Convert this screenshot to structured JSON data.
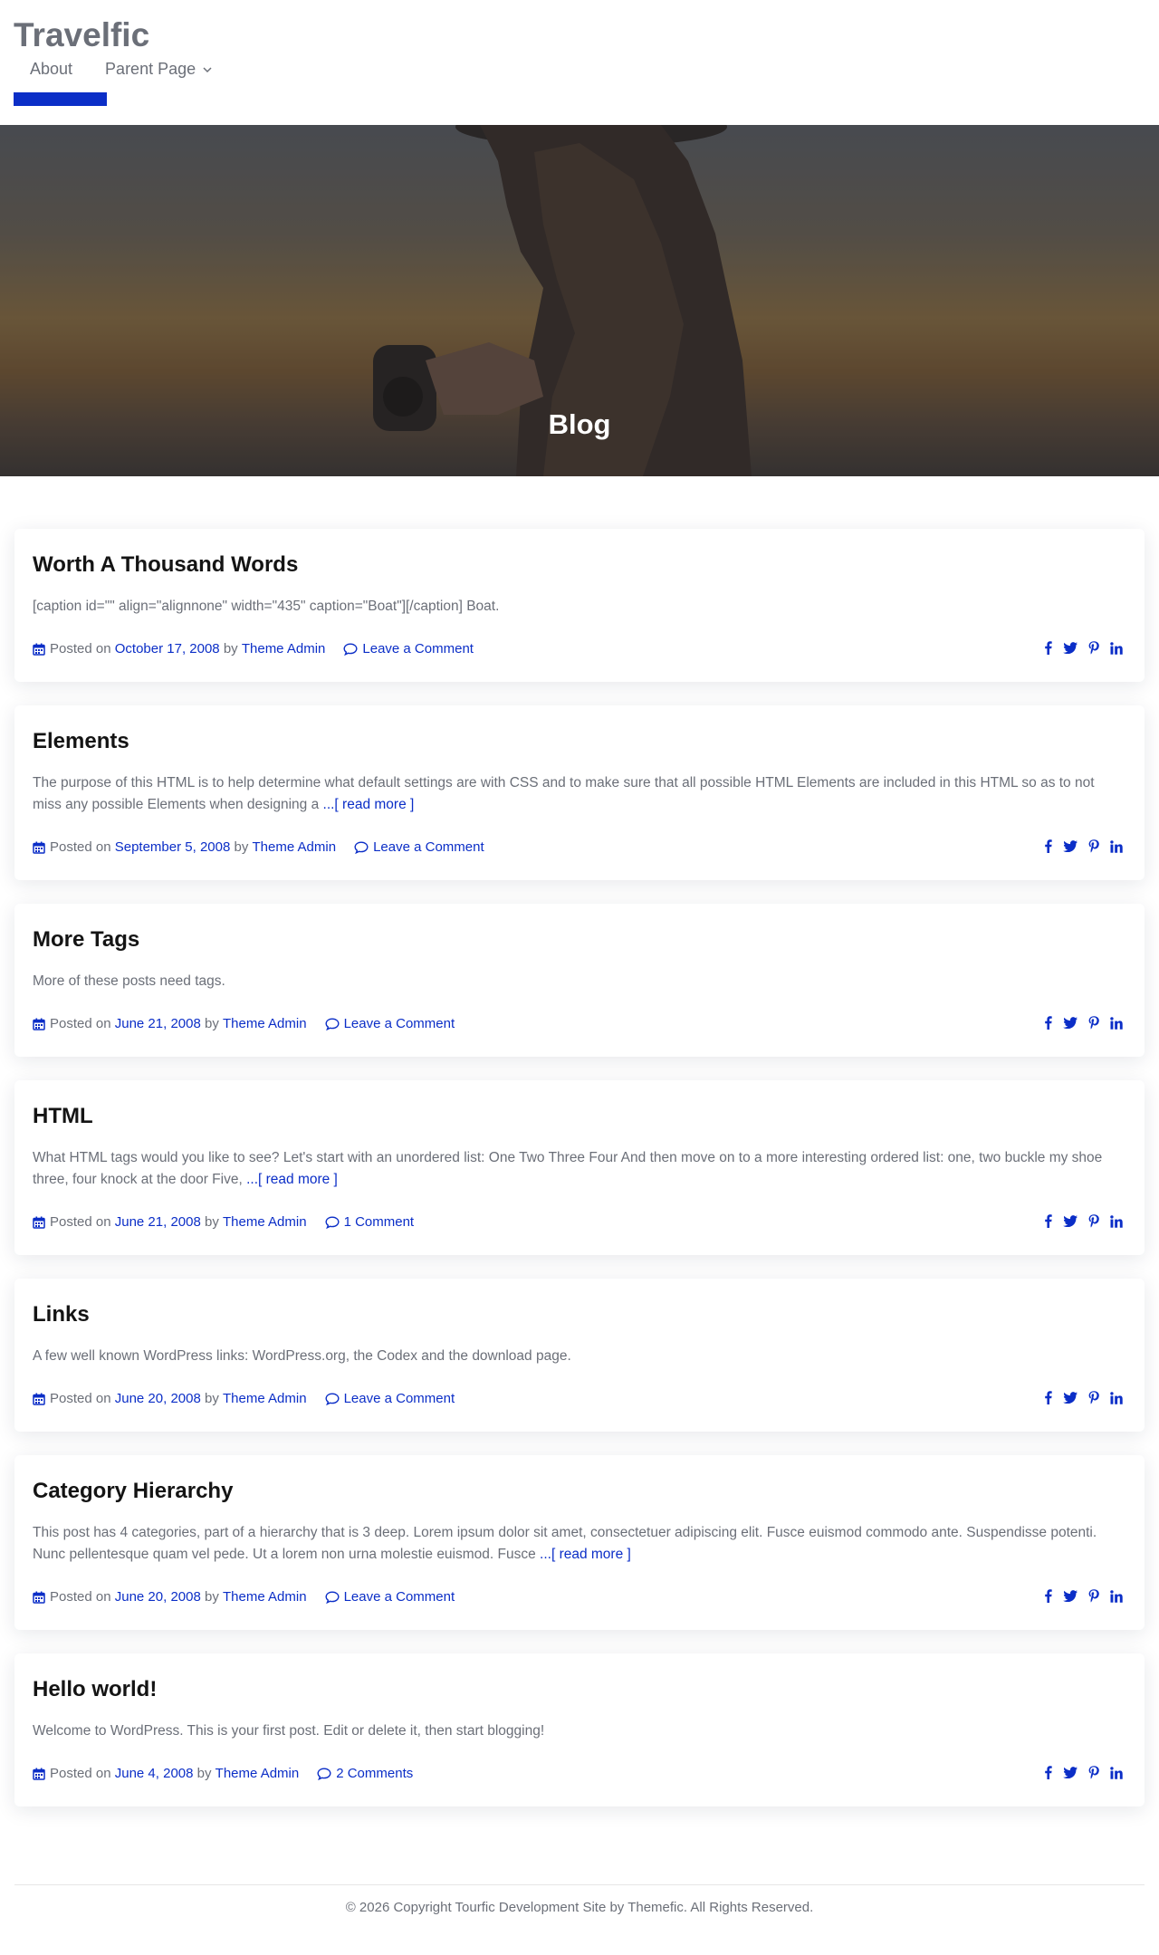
{
  "site": {
    "title": "Travelfic"
  },
  "nav": {
    "items": [
      {
        "label": "About"
      },
      {
        "label": "Parent Page"
      }
    ]
  },
  "hero": {
    "title": "Blog"
  },
  "meta_labels": {
    "posted_on": "Posted on",
    "by": "by"
  },
  "posts": [
    {
      "title": "Worth A Thousand Words",
      "excerpt": "[caption id=\"\" align=\"alignnone\" width=\"435\" caption=\"Boat\"][/caption] Boat.",
      "read_more": "",
      "date": "October 17, 2008",
      "author": "Theme Admin",
      "comments": "Leave a Comment"
    },
    {
      "title": "Elements",
      "excerpt": "The purpose of this HTML is to help determine what default settings are with CSS and to make sure that all possible HTML Elements are included in this HTML so as to not miss any possible Elements when designing a ",
      "read_more": "...[ read more ]",
      "date": "September 5, 2008",
      "author": "Theme Admin",
      "comments": "Leave a Comment"
    },
    {
      "title": "More Tags",
      "excerpt": "More of these posts need tags.",
      "read_more": "",
      "date": "June 21, 2008",
      "author": "Theme Admin",
      "comments": "Leave a Comment"
    },
    {
      "title": "HTML",
      "excerpt": "What HTML tags would you like to see? Let's start with an unordered list: One Two Three Four And then move on to a more interesting ordered list: one, two buckle my shoe three, four knock at the door Five, ",
      "read_more": "...[ read more ]",
      "date": "June 21, 2008",
      "author": "Theme Admin",
      "comments": "1 Comment"
    },
    {
      "title": "Links",
      "excerpt": "A few well known WordPress links: WordPress.org, the Codex and the download page.",
      "read_more": "",
      "date": "June 20, 2008",
      "author": "Theme Admin",
      "comments": "Leave a Comment"
    },
    {
      "title": "Category Hierarchy",
      "excerpt": "This post has 4 categories, part of a hierarchy that is 3 deep. Lorem ipsum dolor sit amet, consectetuer adipiscing elit. Fusce euismod commodo ante. Suspendisse potenti. Nunc pellentesque quam vel pede. Ut a lorem non urna molestie euismod. Fusce ",
      "read_more": "...[ read more ]",
      "date": "June 20, 2008",
      "author": "Theme Admin",
      "comments": "Leave a Comment"
    },
    {
      "title": "Hello world!",
      "excerpt": "Welcome to WordPress. This is your first post. Edit or delete it, then start blogging!",
      "read_more": "",
      "date": "June 4, 2008",
      "author": "Theme Admin",
      "comments": "2 Comments"
    }
  ],
  "share_icons": [
    "facebook-icon",
    "twitter-icon",
    "pinterest-icon",
    "linkedin-icon"
  ],
  "colors": {
    "accent": "#0b2ec7",
    "text": "#6b6f78",
    "heading": "#141414"
  },
  "footer": {
    "copyright": "© 2026 Copyright Tourfic Development Site by Themefic. All Rights Reserved."
  }
}
